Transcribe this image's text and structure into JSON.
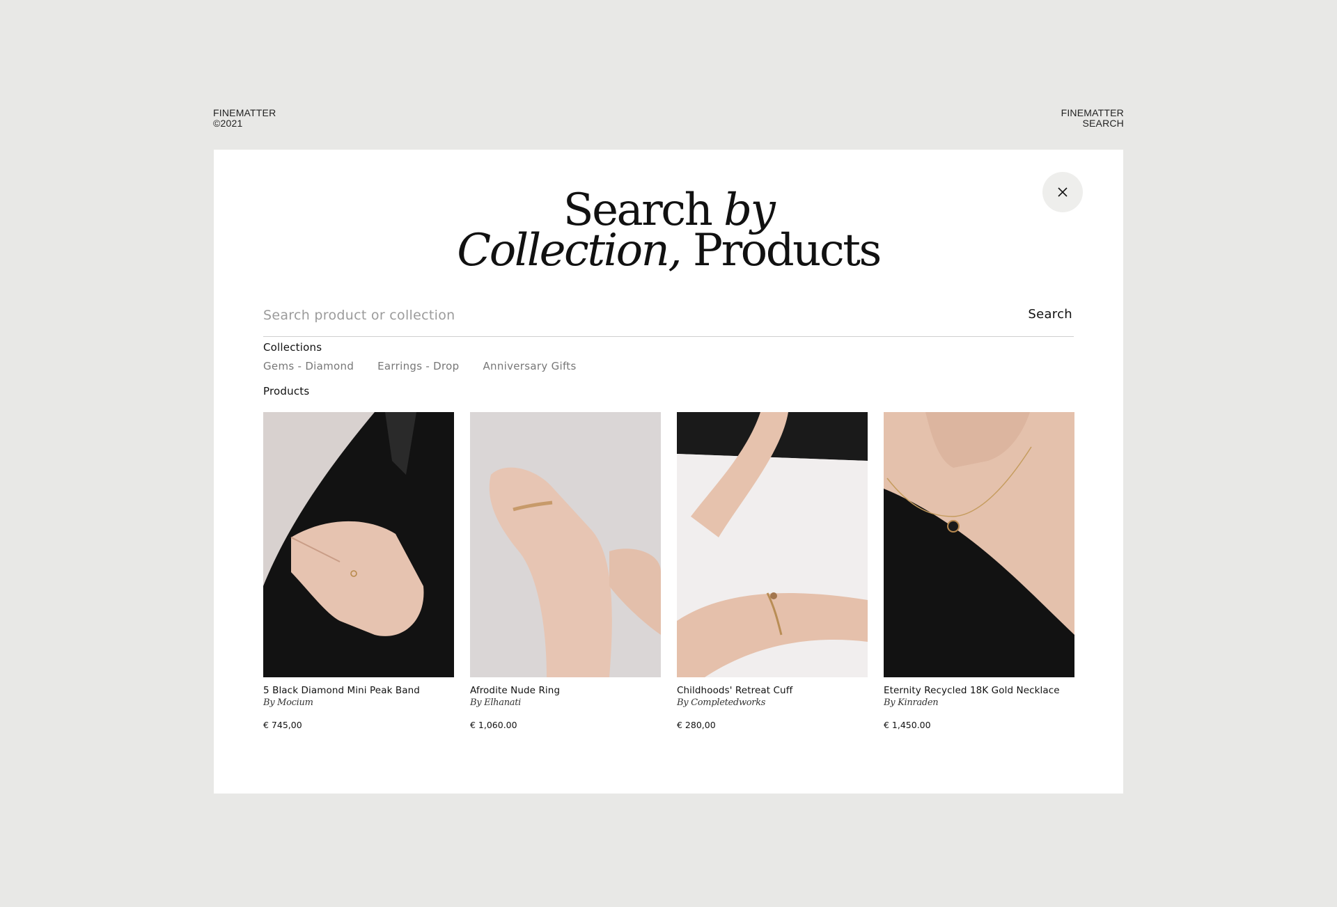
{
  "header": {
    "left": {
      "brand": "FINEMATTER",
      "year": "©2021"
    },
    "right": {
      "brand": "FINEMATTER",
      "section": "SEARCH"
    }
  },
  "modal": {
    "title": {
      "line1_a": "Search ",
      "line1_b": "by",
      "line2_a": "Collection,",
      "line2_b": " Products"
    },
    "close_icon": "close-icon",
    "search": {
      "placeholder": "Search product or collection",
      "value": "",
      "button_label": "Search"
    },
    "collections": {
      "label": "Collections",
      "items": [
        "Gems - Diamond",
        "Earrings - Drop",
        "Anniversary Gifts"
      ]
    },
    "products": {
      "label": "Products",
      "items": [
        {
          "name": "5 Black Diamond Mini Peak Band",
          "brand": "By Mocium",
          "price": "€ 745,00"
        },
        {
          "name": "Afrodite Nude Ring",
          "brand": "By Elhanati",
          "price": "€ 1,060.00"
        },
        {
          "name": "Childhoods' Retreat Cuff",
          "brand": "By Completedworks",
          "price": "€ 280,00"
        },
        {
          "name": "Eternity Recycled 18K Gold Necklace",
          "brand": "By Kinraden",
          "price": "€ 1,450.00"
        }
      ]
    }
  },
  "colors": {
    "page_background": "#e8e8e6",
    "modal_background": "#ffffff",
    "muted_text": "#777777",
    "placeholder": "#9b9b9b"
  }
}
